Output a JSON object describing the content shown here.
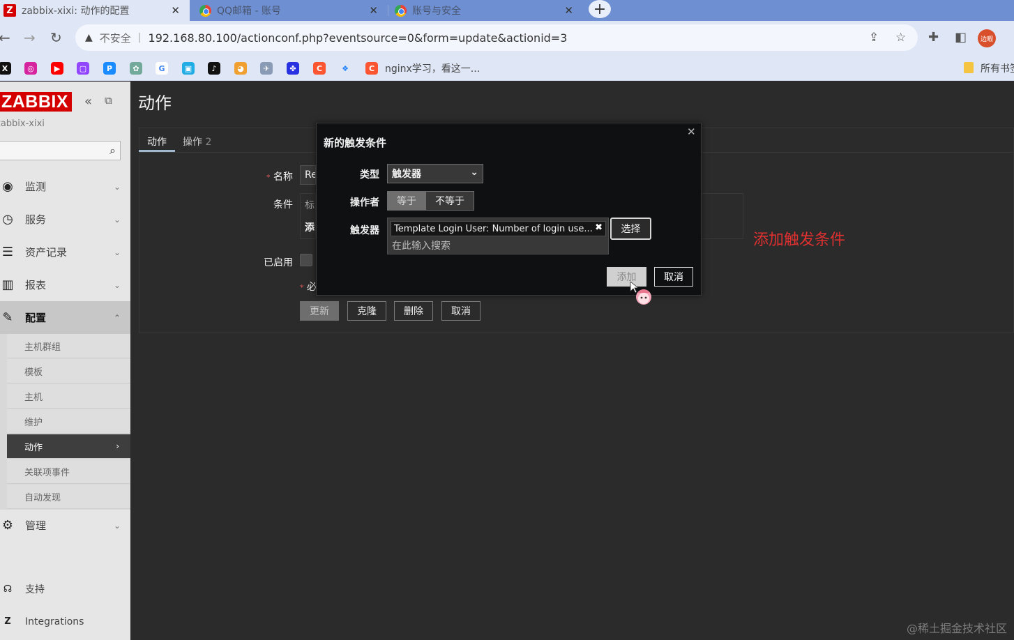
{
  "browser": {
    "tabs": [
      {
        "favicon": "Z",
        "title": "zabbix-xixi: 动作的配置"
      },
      {
        "favicon": "chrome",
        "title": "QQ邮箱 - 账号"
      },
      {
        "favicon": "chrome",
        "title": "账号与安全"
      }
    ],
    "address": {
      "security_label": "不安全",
      "url": "192.168.80.100/actionconf.php?eventsource=0&form=update&actionid=3"
    },
    "profile_badge": "边暇",
    "bookmarks": {
      "nginx_label": "nginx学习，看这一...",
      "all_bookmarks_label": "所有书签"
    }
  },
  "sidebar": {
    "logo": "ZABBIX",
    "server_name": "zabbix-xixi",
    "menu": [
      {
        "icon": "eye-icon",
        "label": "监测"
      },
      {
        "icon": "clock-icon",
        "label": "服务"
      },
      {
        "icon": "list-icon",
        "label": "资产记录"
      },
      {
        "icon": "bar-chart-icon",
        "label": "报表"
      },
      {
        "icon": "wrench-icon",
        "label": "配置"
      },
      {
        "icon": "gear-icon",
        "label": "管理"
      }
    ],
    "config_submenu": [
      "主机群组",
      "模板",
      "主机",
      "维护",
      "动作",
      "关联项事件",
      "自动发现"
    ],
    "support_label": "支持",
    "integrations_label": "Integrations"
  },
  "page": {
    "title": "动作",
    "tabs": [
      {
        "label": "动作"
      },
      {
        "label": "操作",
        "count": "2"
      }
    ],
    "form": {
      "name_label": "名称",
      "name_value": "Re",
      "conditions_label": "条件",
      "conditions_col_value": "标",
      "conditions_add_value": "添",
      "enabled_label": "已启用",
      "required_note": "必"
    },
    "buttons": {
      "update": "更新",
      "clone": "克隆",
      "delete": "删除",
      "cancel": "取消"
    }
  },
  "modal": {
    "title": "新的触发条件",
    "type_label": "类型",
    "type_value": "触发器",
    "operator_label": "操作者",
    "operator_equals": "等于",
    "operator_not_equals": "不等于",
    "trigger_label": "触发器",
    "trigger_chip": "Template Login User: Number of login use...",
    "search_placeholder": "在此输入搜索",
    "select_button": "选择",
    "add_button": "添加",
    "cancel_button": "取消"
  },
  "annotation": "添加触发条件",
  "watermark": "@稀土掘金技术社区",
  "colors": {
    "zabbix_red": "#d40000",
    "annotation_red": "#e03030",
    "tabstrip_blue": "#6e8fd1"
  }
}
